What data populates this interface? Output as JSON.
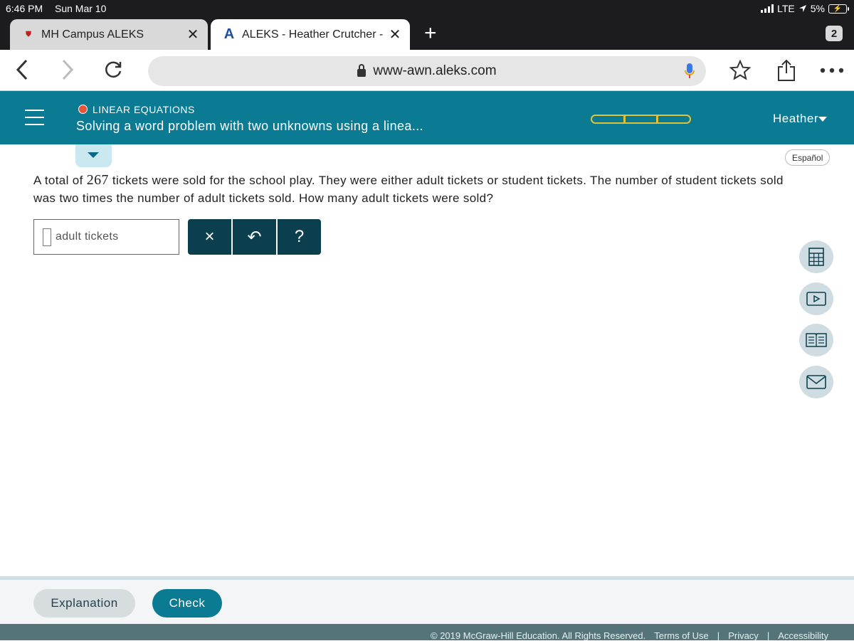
{
  "status_bar": {
    "time": "6:46 PM",
    "date": "Sun Mar 10",
    "network": "LTE",
    "battery": "5%"
  },
  "tabs": [
    {
      "title": "MH Campus ALEKS",
      "favicon": "university-seal-icon",
      "active": false
    },
    {
      "title": "ALEKS - Heather Crutcher -",
      "favicon": "aleks-a-icon",
      "active": true
    }
  ],
  "tab_count": "2",
  "url": "www-awn.aleks.com",
  "header": {
    "topic": "LINEAR EQUATIONS",
    "subtitle": "Solving a word problem with two unknowns using a linea...",
    "progress_segments_filled": 0,
    "progress_segments_total": 3,
    "user": "Heather"
  },
  "language_button": "Español",
  "problem": {
    "text_before": "A total of ",
    "number": "267",
    "text_after": " tickets were sold for the school play. They were either adult tickets or student tickets. The number of student tickets sold was two times the number of adult tickets sold. How many adult tickets were sold?"
  },
  "answer": {
    "value": "",
    "unit_label": "adult tickets"
  },
  "keypad": {
    "clear": "×",
    "undo": "↶",
    "help": "?"
  },
  "side_tools": [
    "calculator-icon",
    "video-icon",
    "textbook-icon",
    "message-icon"
  ],
  "footer": {
    "explanation_label": "Explanation",
    "check_label": "Check",
    "copyright": "© 2019 McGraw-Hill Education. All Rights Reserved.",
    "terms": "Terms of Use",
    "privacy": "Privacy",
    "accessibility": "Accessibility",
    "separator": "|"
  },
  "colors": {
    "header": "#0b7a93",
    "keypad": "#0c3f4d",
    "progress": "#e1c03a",
    "topic_dot": "#e8533a"
  }
}
